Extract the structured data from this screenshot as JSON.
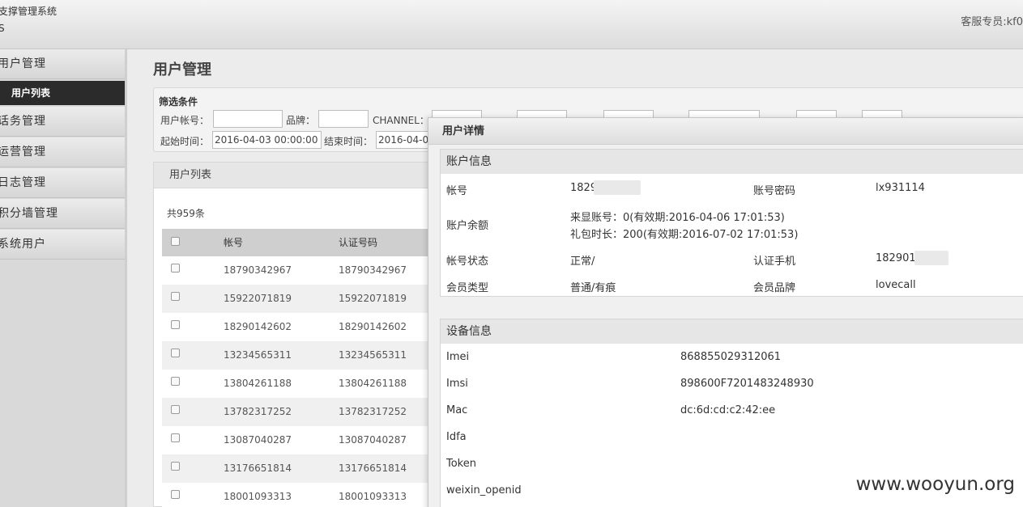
{
  "header": {
    "system_name": "支撑管理系统",
    "system_sub": "S",
    "staff_label": "客服专员:kf0"
  },
  "sidebar": {
    "items": [
      {
        "label": "用户管理"
      },
      {
        "label": "话务管理"
      },
      {
        "label": "运营管理"
      },
      {
        "label": "日志管理"
      },
      {
        "label": "积分墙管理"
      },
      {
        "label": "系统用户"
      }
    ],
    "active_sub": "用户列表"
  },
  "page": {
    "title": "用户管理"
  },
  "filter": {
    "title": "筛选条件",
    "user_account_label": "用户帐号：",
    "brand_label": "品牌：",
    "channel_label": "CHANNEL：",
    "start_label": "起始时间：",
    "start_value": "2016-04-03 00:00:00",
    "end_label": "结束时间：",
    "end_value": "2016-04-0"
  },
  "list": {
    "title": "用户列表",
    "count": "共959条",
    "columns": [
      "帐号",
      "认证号码"
    ],
    "rows": [
      [
        "18790342967",
        "18790342967"
      ],
      [
        "15922071819",
        "15922071819"
      ],
      [
        "18290142602",
        "18290142602"
      ],
      [
        "13234565311",
        "13234565311"
      ],
      [
        "13804261188",
        "13804261188"
      ],
      [
        "13782317252",
        "13782317252"
      ],
      [
        "13087040287",
        "13087040287"
      ],
      [
        "13176651814",
        "13176651814"
      ],
      [
        "18001093313",
        "18001093313"
      ]
    ]
  },
  "modal": {
    "title": "用户详情",
    "account": {
      "title": "账户信息",
      "account_label": "帐号",
      "account_value": "1829",
      "password_label": "账号密码",
      "password_value": "lx931114",
      "balance_label": "账户余额",
      "balance_line1": "来显账号：0(有效期:2016-04-06 17:01:53)",
      "balance_line2": "礼包时长：200(有效期:2016-07-02 17:01:53)",
      "status_label": "帐号状态",
      "status_value": "正常/",
      "phone_label": "认证手机",
      "phone_value": "182901",
      "member_type_label": "会员类型",
      "member_type_value": "普通/有痕",
      "member_brand_label": "会员品牌",
      "member_brand_value": "lovecall"
    },
    "device": {
      "title": "设备信息",
      "imei_label": "Imei",
      "imei_value": "868855029312061",
      "imsi_label": "Imsi",
      "imsi_value": "898600F7201483248930",
      "mac_label": "Mac",
      "mac_value": "dc:6d:cd:c2:42:ee",
      "idfa_label": "Idfa",
      "token_label": "Token",
      "weixin_label": "weixin_openid"
    }
  },
  "watermark": "www.wooyun.org"
}
